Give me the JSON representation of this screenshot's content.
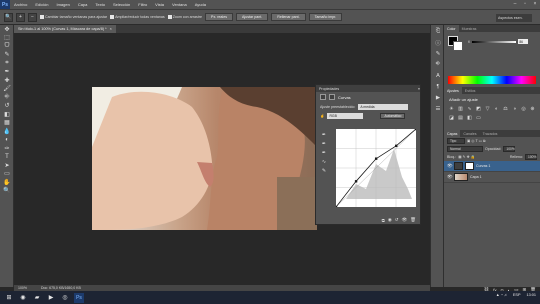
{
  "app": {
    "logo": "Ps"
  },
  "menubar": {
    "items": [
      "Archivo",
      "Edición",
      "Imagen",
      "Capa",
      "Texto",
      "Selección",
      "Filtro",
      "Vista",
      "Ventana",
      "Ayuda"
    ]
  },
  "options": {
    "size_label": "Cambiar tamaño ventanas para ajustar",
    "zoom_all_label": "Ampliar/reducir todas ventanas",
    "scrubby_label": "Zoom con arrastre",
    "btn_100": "Px. reales",
    "btn_fit": "Ajustar pant.",
    "btn_fill": "Rellenar pant.",
    "btn_print": "Tamaño impr.",
    "workspace": "Aspectos esen."
  },
  "document": {
    "tab_title": "Sin título-1 al 100% (Curvas 1, Máscara de capa/8) *",
    "close": "×"
  },
  "status": {
    "zoom": "100%",
    "doc": "Doc: 675,0 KB/1650,0 KB"
  },
  "properties": {
    "panel_title": "Propiedades",
    "heading": "Curvas",
    "preset_label": "Ajuste preestablecido:",
    "preset_value": "A medida",
    "channel_value": "RGB",
    "auto_label": "Automático"
  },
  "panels": {
    "color_tab": "Color",
    "swatches_tab": "Muestras",
    "slider_k_label": "K",
    "slider_k_value": "86",
    "adjust_tab": "Ajustes",
    "styles_tab": "Estilos",
    "adjust_title": "Añadir un ajuste",
    "layers_tab": "Capas",
    "channels_tab": "Canales",
    "paths_tab": "Trazados",
    "kind_label": "Tipo",
    "blend_mode": "Normal",
    "opacity_label": "Opacidad:",
    "opacity_value": "100%",
    "lock_label": "Bloq.:",
    "fill_label": "Relleno:",
    "fill_value": "100%",
    "layers": [
      {
        "name": "Curvas 1",
        "active": true
      },
      {
        "name": "Capa 1",
        "active": false
      }
    ]
  },
  "taskbar": {
    "lang": "ESP",
    "time": "13:01"
  },
  "icons": {
    "tools": [
      "move-icon",
      "marquee-icon",
      "lasso-icon",
      "quick-select-icon",
      "crop-icon",
      "eyedropper-icon",
      "healing-icon",
      "brush-icon",
      "stamp-icon",
      "history-brush-icon",
      "eraser-icon",
      "gradient-icon",
      "blur-icon",
      "dodge-icon",
      "pen-icon",
      "type-icon",
      "path-select-icon",
      "shape-icon",
      "hand-icon",
      "zoom-icon"
    ],
    "tool_glyphs": [
      "✥",
      "⬚",
      "ᗜ",
      "✎",
      "⌗",
      "✒",
      "✚",
      "🖌",
      "⎆",
      "↺",
      "◧",
      "▦",
      "💧",
      "◐",
      "✑",
      "T",
      "➤",
      "▭",
      "✋",
      "🔍"
    ]
  },
  "curve": {
    "points": [
      [
        0,
        0
      ],
      [
        64,
        84
      ],
      [
        128,
        158
      ],
      [
        192,
        200
      ],
      [
        255,
        255
      ]
    ]
  }
}
